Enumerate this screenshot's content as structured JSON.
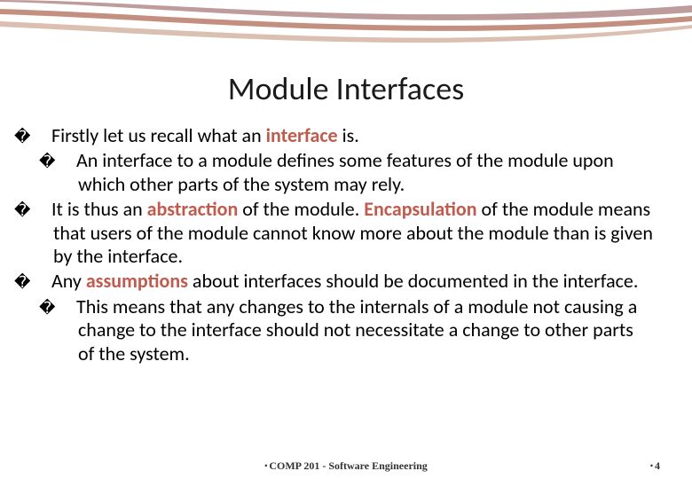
{
  "title": "Module Interfaces",
  "bullets": {
    "b1_pre": "Firstly let us recall what an ",
    "b1_kw": "interface",
    "b1_post": " is.",
    "b2": "An interface to a module defines some features of the module upon which other parts of the system may rely.",
    "b3_pre": "It is thus an ",
    "b3_kw1": "abstraction",
    "b3_mid": " of the module. ",
    "b3_kw2": "Encapsulation",
    "b3_post": " of the module means that users of the module cannot know more about the module than is given by the interface.",
    "b4_pre": "Any ",
    "b4_kw": "assumptions",
    "b4_post": " about interfaces should be documented in the interface.",
    "b5": "This means that any changes to the internals of a module not causing a change to the interface should not necessitate a change to other parts of the system."
  },
  "footer": {
    "course": "COMP 201 - Software Engineering",
    "page": "4"
  },
  "bullet_glyph": "�",
  "footer_bullet": "•"
}
